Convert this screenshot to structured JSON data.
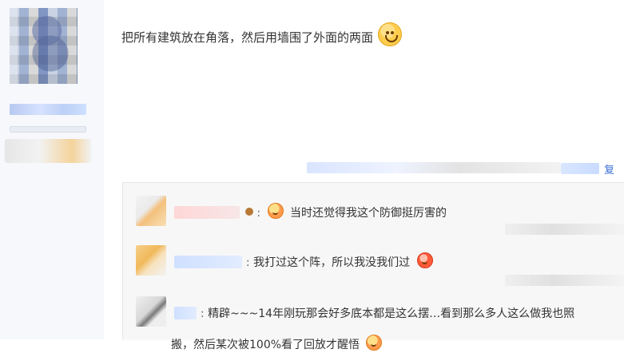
{
  "post": {
    "text": "把所有建筑放在角落，然后用墙围了外面的两面",
    "emoji_icon": "grin-emoji-icon"
  },
  "actions": {
    "reply_label": "复"
  },
  "replies": [
    {
      "text": "当时还觉得我这个防御挺厉害的",
      "emoji_icon": "tongue-emoji-icon"
    },
    {
      "text": "我打过这个阵，所以我没我们过",
      "emoji_icon": "angry-emoji-icon"
    },
    {
      "text_line1": "精辟~~~14年刚玩那会好多底本都是这么摆…看到那么多人这么做我也照",
      "text_line2": "搬，然后某次被100%看了回放才醒悟",
      "emoji_icon": "laugh-cry-emoji-icon"
    }
  ],
  "colors": {
    "background": "#ffffff",
    "sidebar": "#f6f8fc",
    "reply_panel": "#f7f7f7",
    "link": "#3a6fd8",
    "text": "#333333"
  }
}
